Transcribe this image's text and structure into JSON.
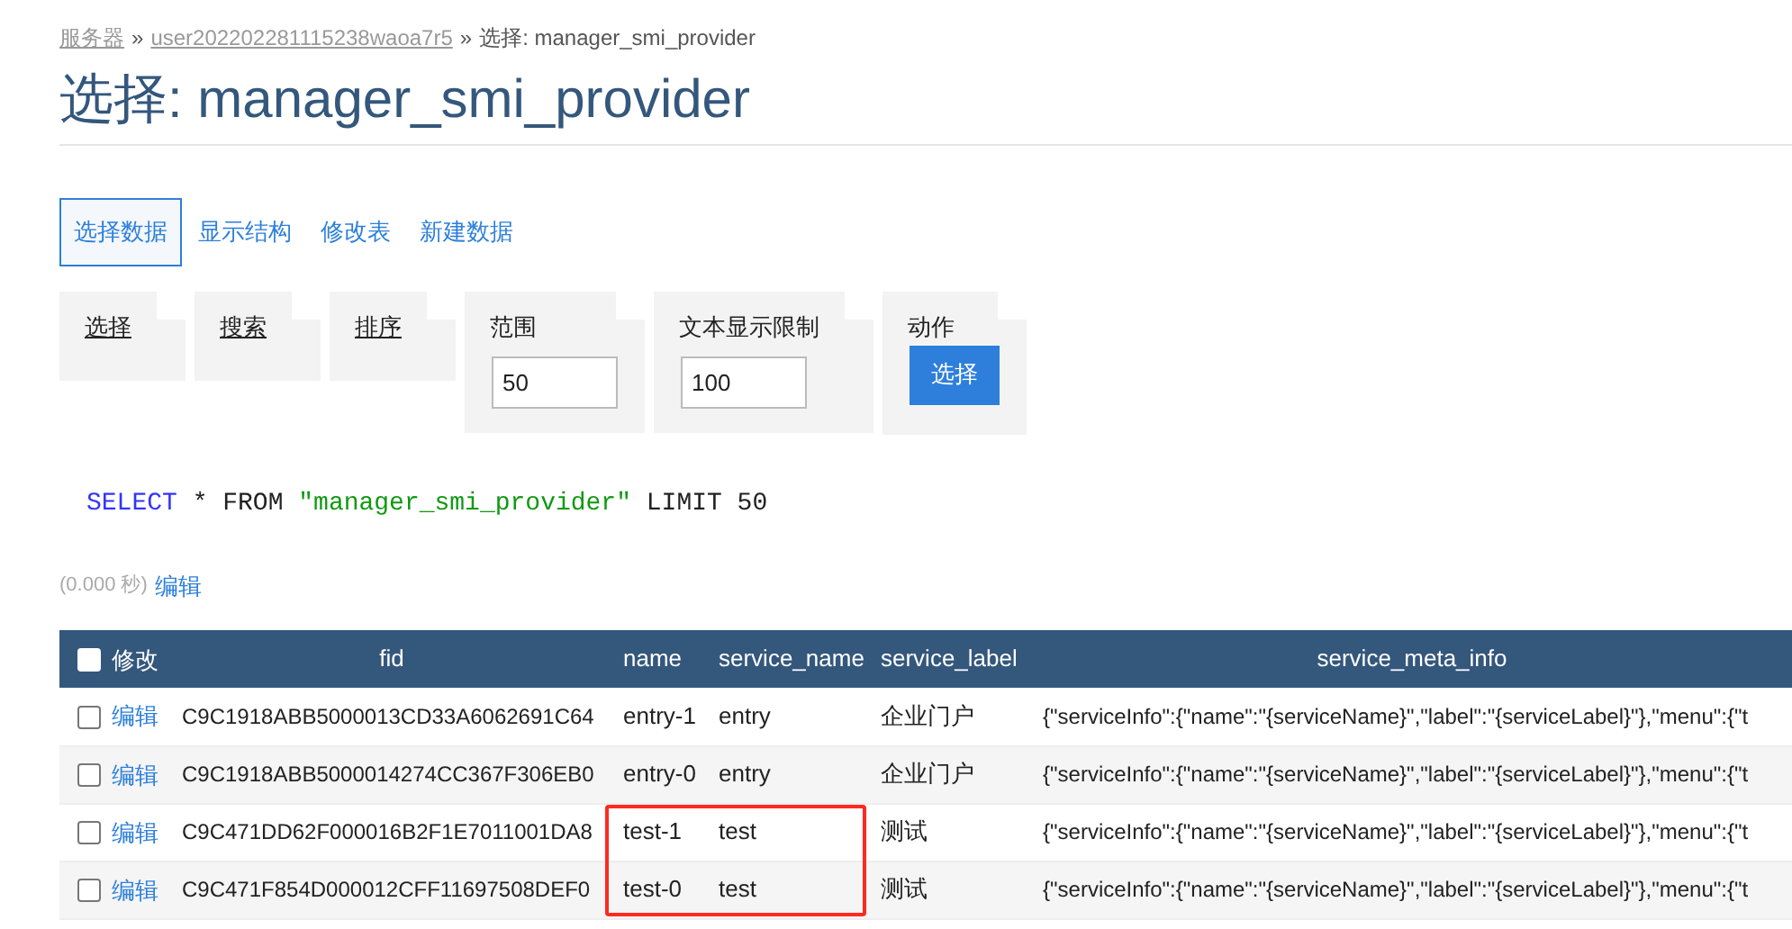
{
  "breadcrumb": [
    {
      "text": "服务器",
      "kind": "link"
    },
    {
      "text": "»",
      "kind": "separator"
    },
    {
      "text": "user202202281115238waoa7r5",
      "kind": "link"
    },
    {
      "text": "»",
      "kind": "separator"
    },
    {
      "text": "选择: manager_smi_provider",
      "kind": "current"
    }
  ],
  "title": "选择: manager_smi_provider",
  "tabs": [
    {
      "label": "选择数据",
      "selected": true
    },
    {
      "label": "显示结构",
      "selected": false
    },
    {
      "label": "修改表",
      "selected": false
    },
    {
      "label": "新建数据",
      "selected": false
    }
  ],
  "fieldsets": [
    {
      "legend": "选择",
      "kind": "link"
    },
    {
      "legend": "搜索",
      "kind": "link"
    },
    {
      "legend": "排序",
      "kind": "link"
    },
    {
      "legend": "范围",
      "kind": "input",
      "value": "50"
    },
    {
      "legend": "文本显示限制",
      "kind": "input",
      "value": "100"
    },
    {
      "legend": "动作",
      "kind": "button",
      "button": "选择"
    }
  ],
  "sql": [
    {
      "text": "SELECT",
      "kind": "keyword"
    },
    {
      "text": " * FROM ",
      "kind": "plain"
    },
    {
      "text": "\"manager_smi_provider\"",
      "kind": "string"
    },
    {
      "text": " LIMIT 50",
      "kind": "plain"
    }
  ],
  "timing": "(0.000 秒)",
  "edit_link": "编辑",
  "table": {
    "select_all_checked": false,
    "edit_header": "修改",
    "columns": [
      "fid",
      "name",
      "service_name",
      "service_label",
      "service_meta_info"
    ],
    "rows": [
      {
        "checked": false,
        "edit": "编辑",
        "highlighted": false,
        "cells": [
          "C9C1918ABB5000013CD33A6062691C64",
          "entry-1",
          "entry",
          "企业门户",
          "{\"serviceInfo\":{\"name\":\"{serviceName}\",\"label\":\"{serviceLabel}\"},\"menu\":{\"t"
        ]
      },
      {
        "checked": false,
        "edit": "编辑",
        "highlighted": false,
        "cells": [
          "C9C1918ABB5000014274CC367F306EB0",
          "entry-0",
          "entry",
          "企业门户",
          "{\"serviceInfo\":{\"name\":\"{serviceName}\",\"label\":\"{serviceLabel}\"},\"menu\":{\"t"
        ]
      },
      {
        "checked": false,
        "edit": "编辑",
        "highlighted": true,
        "cells": [
          "C9C471DD62F000016B2F1E7011001DA8",
          "test-1",
          "test",
          "测试",
          "{\"serviceInfo\":{\"name\":\"{serviceName}\",\"label\":\"{serviceLabel}\"},\"menu\":{\"t"
        ]
      },
      {
        "checked": false,
        "edit": "编辑",
        "highlighted": true,
        "cells": [
          "C9C471F854D000012CFF11697508DEF0",
          "test-0",
          "test",
          "测试",
          "{\"serviceInfo\":{\"name\":\"{serviceName}\",\"label\":\"{serviceLabel}\"},\"menu\":{\"t"
        ]
      }
    ]
  }
}
